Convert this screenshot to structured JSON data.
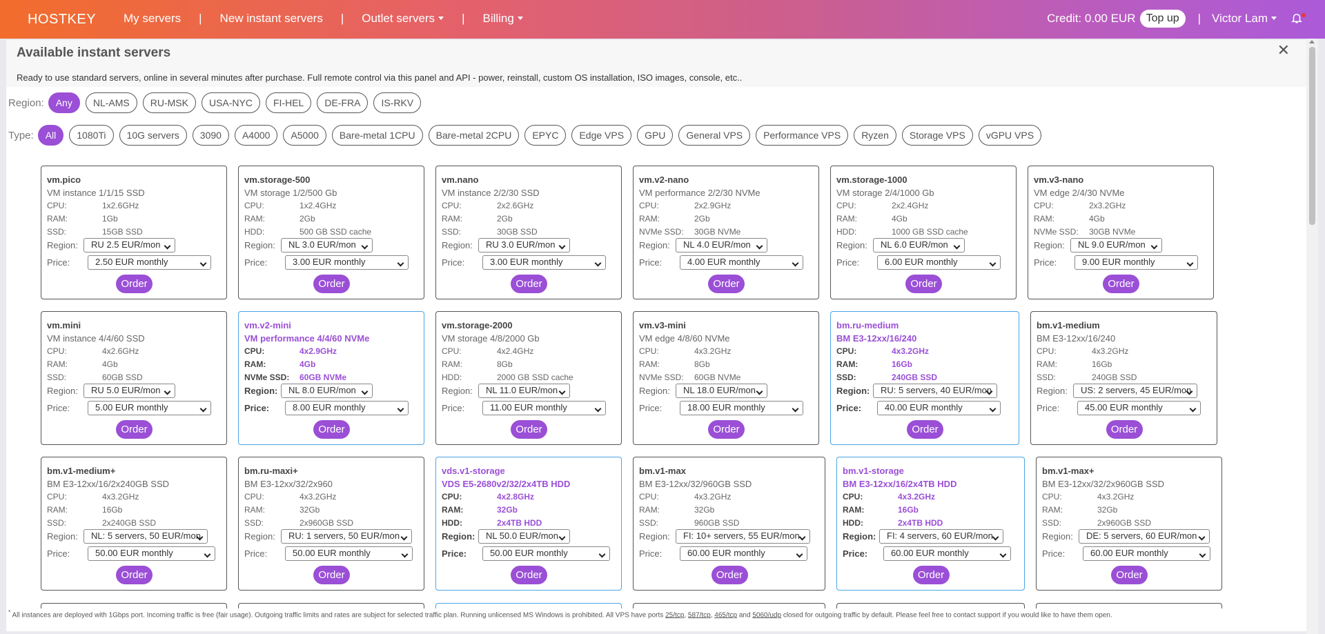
{
  "nav": {
    "brand": "HOSTKEY",
    "items": [
      "My servers",
      "New instant servers",
      "Outlet servers",
      "Billing"
    ],
    "separator": "|",
    "credit": "Credit: 0.00 EUR",
    "topup": "Top up",
    "user": "Victor Lam"
  },
  "panel": {
    "title": "Available instant servers",
    "close": "✕",
    "description": "Ready to use standard servers, online in several minutes after purchase. Full remote control via this panel and API - power, reinstall, custom OS installation, ISO images, console, etc.."
  },
  "filters": {
    "region_label": "Region:",
    "regions": [
      "Any",
      "NL-AMS",
      "RU-MSK",
      "USA-NYC",
      "FI-HEL",
      "DE-FRA",
      "IS-RKV"
    ],
    "type_label": "Type:",
    "types": [
      "All",
      "1080Ti",
      "10G servers",
      "3090",
      "A4000",
      "A5000",
      "Bare-metal 1CPU",
      "Bare-metal 2CPU",
      "EPYC",
      "Edge VPS",
      "GPU",
      "General VPS",
      "Performance VPS",
      "Ryzen",
      "Storage VPS",
      "vGPU VPS"
    ]
  },
  "labels": {
    "cpu": "CPU:",
    "ram": "RAM:",
    "region": "Region:",
    "price": "Price:",
    "order": "Order"
  },
  "cards": [
    {
      "name": "vm.pico",
      "sub": "VM instance 1/1/15 SSD",
      "cpu": "1x2.6GHz",
      "ram": "1Gb",
      "disk_label": "SSD:",
      "disk": "15GB SSD",
      "region": "RU 2.5 EUR/mon",
      "price": "2.50 EUR monthly",
      "featured": false
    },
    {
      "name": "vm.storage-500",
      "sub": "VM storage 1/2/500 Gb",
      "cpu": "1x2.4GHz",
      "ram": "2Gb",
      "disk_label": "HDD:",
      "disk": "500 GB SSD cache",
      "region": "NL 3.0 EUR/mon",
      "price": "3.00 EUR monthly",
      "featured": false
    },
    {
      "name": "vm.nano",
      "sub": "VM instance 2/2/30 SSD",
      "cpu": "2x2.6GHz",
      "ram": "2Gb",
      "disk_label": "SSD:",
      "disk": "30GB SSD",
      "region": "RU 3.0 EUR/mon",
      "price": "3.00 EUR monthly",
      "featured": false
    },
    {
      "name": "vm.v2-nano",
      "sub": "VM performance 2/2/30 NVMe",
      "cpu": "2x2.9GHz",
      "ram": "2Gb",
      "disk_label": "NVMe SSD:",
      "disk": "30GB NVMe",
      "region": "NL 4.0 EUR/mon",
      "price": "4.00 EUR monthly",
      "featured": false
    },
    {
      "name": "vm.storage-1000",
      "sub": "VM storage 2/4/1000 Gb",
      "cpu": "2x2.4GHz",
      "ram": "4Gb",
      "disk_label": "HDD:",
      "disk": "1000 GB SSD cache",
      "region": "NL 6.0 EUR/mon",
      "price": "6.00 EUR monthly",
      "featured": false
    },
    {
      "name": "vm.v3-nano",
      "sub": "VM edge 2/4/30 NVMe",
      "cpu": "2x3.2GHz",
      "ram": "4Gb",
      "disk_label": "NVMe SSD:",
      "disk": "30GB NVMe",
      "region": "NL 9.0 EUR/mon",
      "price": "9.00 EUR monthly",
      "featured": false
    },
    {
      "name": "vm.mini",
      "sub": "VM instance 4/4/60 SSD",
      "cpu": "4x2.6GHz",
      "ram": "4Gb",
      "disk_label": "SSD:",
      "disk": "60GB SSD",
      "region": "RU 5.0 EUR/mon",
      "price": "5.00 EUR monthly",
      "featured": false
    },
    {
      "name": "vm.v2-mini",
      "sub": "VM performance 4/4/60 NVMe",
      "cpu": "4x2.9GHz",
      "ram": "4Gb",
      "disk_label": "NVMe SSD:",
      "disk": "60GB NVMe",
      "region": "NL 8.0 EUR/mon",
      "price": "8.00 EUR monthly",
      "featured": true
    },
    {
      "name": "vm.storage-2000",
      "sub": "VM storage 4/8/2000 Gb",
      "cpu": "4x2.4GHz",
      "ram": "8Gb",
      "disk_label": "HDD:",
      "disk": "2000 GB SSD cache",
      "region": "NL 11.0 EUR/mon",
      "price": "11.00 EUR monthly",
      "featured": false
    },
    {
      "name": "vm.v3-mini",
      "sub": "VM edge 4/8/60 NVMe",
      "cpu": "4x3.2GHz",
      "ram": "8Gb",
      "disk_label": "NVMe SSD:",
      "disk": "60GB NVMe",
      "region": "NL 18.0 EUR/mon",
      "price": "18.00 EUR monthly",
      "featured": false
    },
    {
      "name": "bm.ru-medium",
      "sub": "BM E3-12xx/16/240",
      "cpu": "4x3.2GHz",
      "ram": "16Gb",
      "disk_label": "SSD:",
      "disk": "240GB SSD",
      "region": "RU: 5 servers, 40 EUR/mon",
      "price": "40.00 EUR monthly",
      "featured": true
    },
    {
      "name": "bm.v1-medium",
      "sub": "BM E3-12xx/16/240",
      "cpu": "4x3.2GHz",
      "ram": "16Gb",
      "disk_label": "SSD:",
      "disk": "240GB SSD",
      "region": "US: 2 servers, 45 EUR/mon",
      "price": "45.00 EUR monthly",
      "featured": false
    },
    {
      "name": "bm.v1-medium+",
      "sub": "BM E3-12xx/16/2x240GB SSD",
      "cpu": "4x3.2GHz",
      "ram": "16Gb",
      "disk_label": "SSD:",
      "disk": "2x240GB SSD",
      "region": "NL: 5 servers, 50 EUR/mon",
      "price": "50.00 EUR monthly",
      "featured": false
    },
    {
      "name": "bm.ru-maxi+",
      "sub": "BM E3-12xx/32/2x960",
      "cpu": "4x3.2GHz",
      "ram": "32Gb",
      "disk_label": "SSD:",
      "disk": "2x960GB SSD",
      "region": "RU: 1 servers, 50 EUR/mon",
      "price": "50.00 EUR monthly",
      "featured": false
    },
    {
      "name": "vds.v1-storage",
      "sub": "VDS E5-2680v2/32/2x4TB HDD",
      "cpu": "4x2.8GHz",
      "ram": "32Gb",
      "disk_label": "HDD:",
      "disk": "2x4TB HDD",
      "region": "NL 50.0 EUR/mon",
      "price": "50.00 EUR monthly",
      "featured": true
    },
    {
      "name": "bm.v1-max",
      "sub": "BM E3-12xx/32/960GB SSD",
      "cpu": "4x3.2GHz",
      "ram": "32Gb",
      "disk_label": "SSD:",
      "disk": "960GB SSD",
      "region": "FI: 10+ servers, 55 EUR/mon",
      "price": "60.00 EUR monthly",
      "featured": false
    },
    {
      "name": "bm.v1-storage",
      "sub": "BM E3-12xx/16/2x4TB HDD",
      "cpu": "4x3.2GHz",
      "ram": "16Gb",
      "disk_label": "HDD:",
      "disk": "2x4TB HDD",
      "region": "FI: 4 servers, 60 EUR/mon",
      "price": "60.00 EUR monthly",
      "featured": true
    },
    {
      "name": "bm.v1-max+",
      "sub": "BM E3-12xx/32/2x960GB SSD",
      "cpu": "4x3.2GHz",
      "ram": "32Gb",
      "disk_label": "SSD:",
      "disk": "2x960GB SSD",
      "region": "DE: 5 servers, 60 EUR/mon",
      "price": "60.00 EUR monthly",
      "featured": false
    }
  ],
  "footnote": {
    "star": "*",
    "text_a": "All instances are deployed with 1Gbps port. Incoming traffic is free (fair usage). Outgoing traffic limits and rates are subject for selected traffic plan. Running unlicensed MS Windows is prohibited. All VPS have ports ",
    "p1": "25/tcp",
    "sep1": ", ",
    "p2": "587/tcp",
    "sep2": ", ",
    "p3": "465/tcp",
    "and": " and ",
    "p4": "5060/udp",
    "text_b": " closed for outgoing traffic by default. Please feel free to contact support if you would like to have them open."
  },
  "colors": {
    "accent": "#9a4fd6",
    "featured_border": "#4aa5e5",
    "nav_start": "#f26d2c",
    "nav_end": "#ab5ad8"
  }
}
